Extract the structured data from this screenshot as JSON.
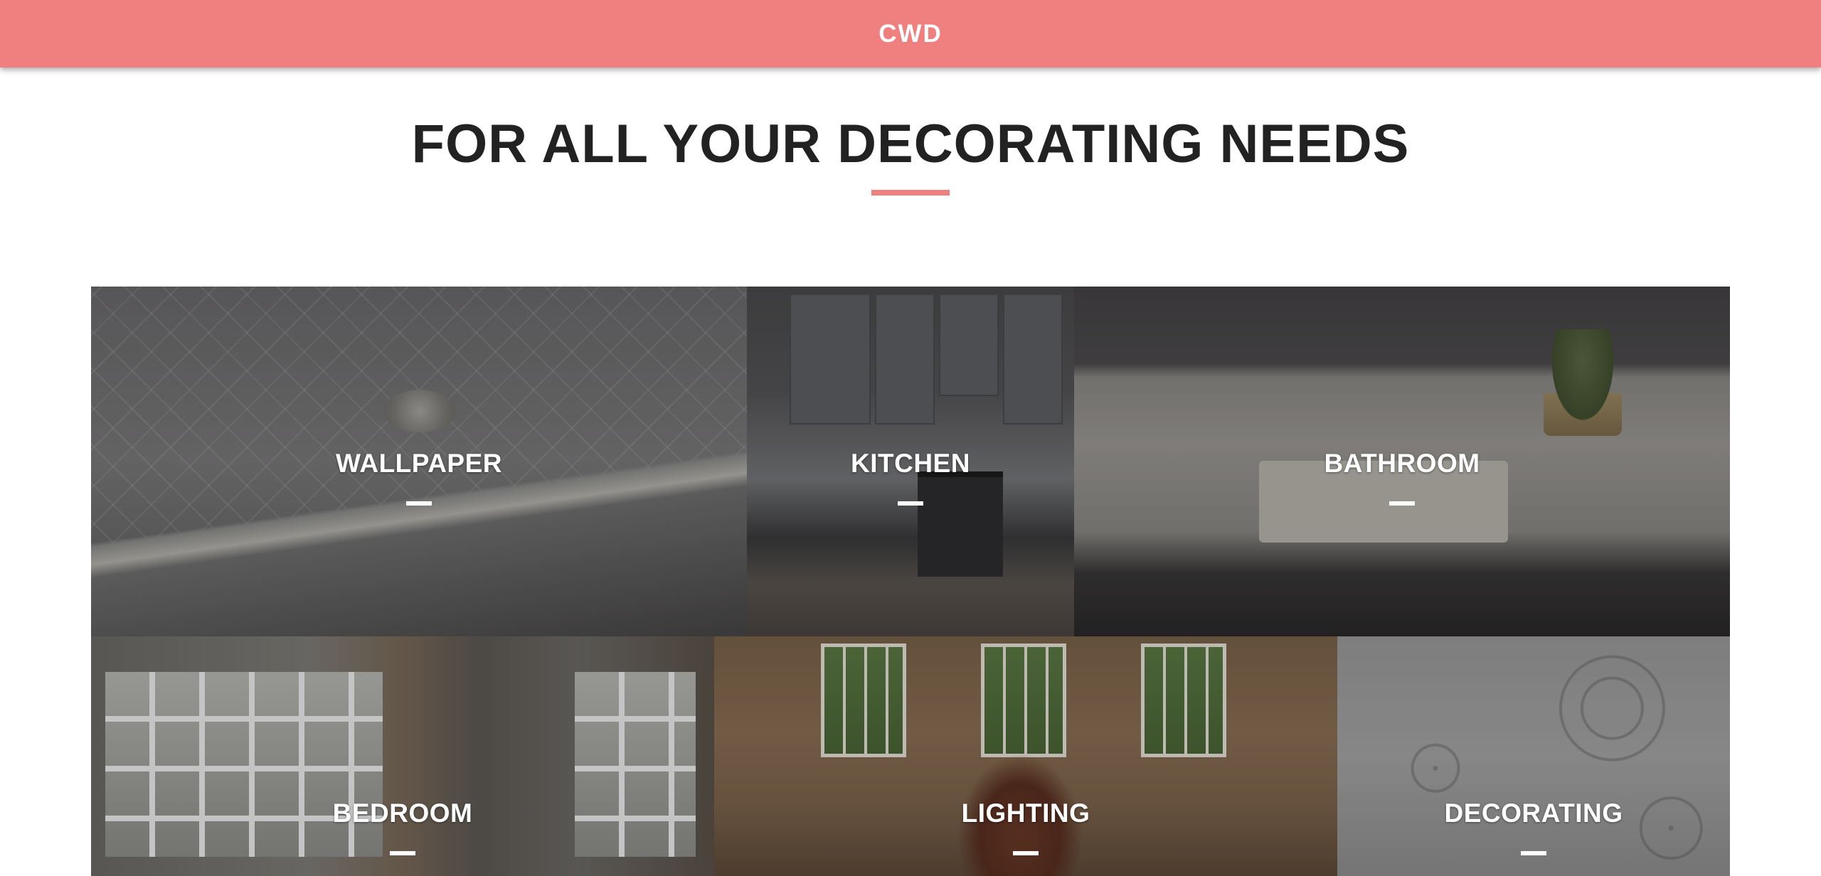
{
  "header": {
    "brand": "CWD",
    "background_color": "#f08080"
  },
  "hero": {
    "title": "FOR ALL YOUR DECORATING NEEDS",
    "accent_color": "#f08080"
  },
  "categories": [
    {
      "label": "WALLPAPER"
    },
    {
      "label": "KITCHEN"
    },
    {
      "label": "BATHROOM"
    },
    {
      "label": "BEDROOM"
    },
    {
      "label": "LIGHTING"
    },
    {
      "label": "DECORATING"
    }
  ]
}
